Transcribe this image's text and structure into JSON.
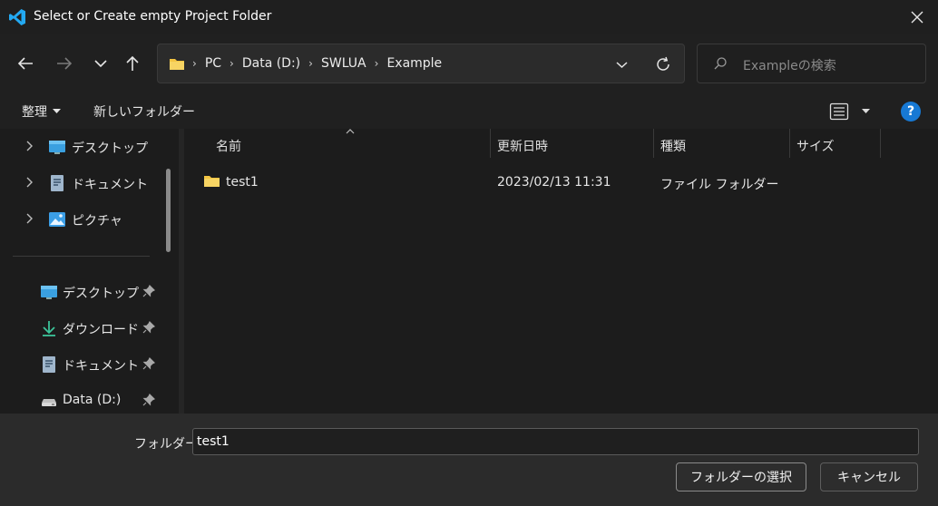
{
  "window": {
    "title": "Select or Create empty Project Folder"
  },
  "nav": {
    "breadcrumbs": [
      "PC",
      "Data (D:)",
      "SWLUA",
      "Example"
    ],
    "search_placeholder": "Exampleの検索"
  },
  "command_bar": {
    "organize": "整理",
    "new_folder": "新しいフォルダー"
  },
  "sidebar": {
    "tree_items": [
      {
        "label": "デスクトップ",
        "icon": "desktop-icon"
      },
      {
        "label": "ドキュメント",
        "icon": "document-icon"
      },
      {
        "label": "ピクチャ",
        "icon": "pictures-icon"
      }
    ],
    "quick_access": [
      {
        "label": "デスクトップ",
        "icon": "desktop-icon"
      },
      {
        "label": "ダウンロード",
        "icon": "download-icon"
      },
      {
        "label": "ドキュメント",
        "icon": "document-icon"
      },
      {
        "label": "Data (D:)",
        "icon": "drive-icon"
      }
    ]
  },
  "columns": [
    "名前",
    "更新日時",
    "種類",
    "サイズ"
  ],
  "files": [
    {
      "name": "test1",
      "modified": "2023/02/13 11:31",
      "type": "ファイル フォルダー",
      "size": ""
    }
  ],
  "footer": {
    "folder_label": "フォルダー:",
    "folder_value": "test1",
    "select_button": "フォルダーの選択",
    "cancel_button": "キャンセル"
  },
  "colors": {
    "accent": "#1779d4",
    "folder": "#f4c542",
    "vscode_blue": "#23a9f2"
  }
}
